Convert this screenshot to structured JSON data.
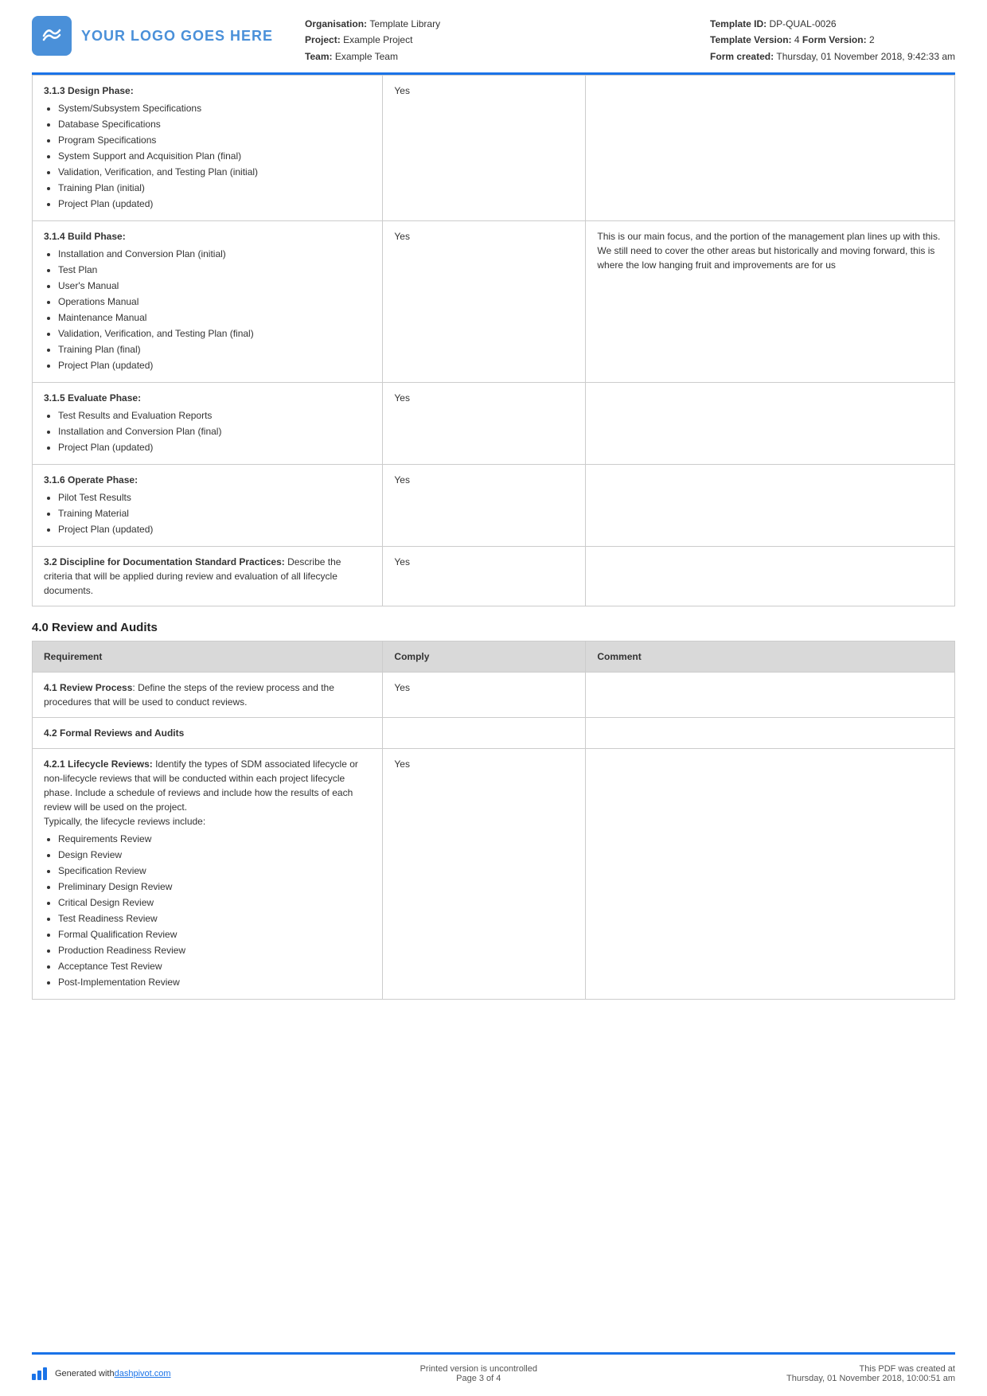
{
  "header": {
    "logo_text": "YOUR LOGO GOES HERE",
    "org_label": "Organisation:",
    "org_value": "Template Library",
    "project_label": "Project:",
    "project_value": "Example Project",
    "team_label": "Team:",
    "team_value": "Example Team",
    "template_id_label": "Template ID:",
    "template_id_value": "DP-QUAL-0026",
    "template_version_label": "Template Version:",
    "template_version_value": "4",
    "form_version_label": "Form Version:",
    "form_version_value": "2",
    "form_created_label": "Form created:",
    "form_created_value": "Thursday, 01 November 2018, 9:42:33 am"
  },
  "table1": {
    "rows": [
      {
        "id": "313",
        "requirement": "3.1.3 Design Phase:",
        "bullets": [
          "System/Subsystem Specifications",
          "Database Specifications",
          "Program Specifications",
          "System Support and Acquisition Plan (final)",
          "Validation, Verification, and Testing Plan (initial)",
          "Training Plan (initial)",
          "Project Plan (updated)"
        ],
        "comply": "Yes",
        "comment": ""
      },
      {
        "id": "314",
        "requirement": "3.1.4 Build Phase:",
        "bullets": [
          "Installation and Conversion Plan (initial)",
          "Test Plan",
          "User's Manual",
          "Operations Manual",
          "Maintenance Manual",
          "Validation, Verification, and Testing Plan (final)",
          "Training Plan (final)",
          "Project Plan (updated)"
        ],
        "comply": "Yes",
        "comment": "This is our main focus, and the portion of the management plan lines up with this. We still need to cover the other areas but historically and moving forward, this is where the low hanging fruit and improvements are for us"
      },
      {
        "id": "315",
        "requirement": "3.1.5 Evaluate Phase:",
        "bullets": [
          "Test Results and Evaluation Reports",
          "Installation and Conversion Plan (final)",
          "Project Plan (updated)"
        ],
        "comply": "Yes",
        "comment": ""
      },
      {
        "id": "316",
        "requirement": "3.1.6 Operate Phase:",
        "bullets": [
          "Pilot Test Results",
          "Training Material",
          "Project Plan (updated)"
        ],
        "comply": "Yes",
        "comment": ""
      },
      {
        "id": "32",
        "requirement_bold": "3.2 Discipline for Documentation Standard Practices:",
        "requirement_text": " Describe the criteria that will be applied during review and evaluation of all lifecycle documents.",
        "bullets": [],
        "comply": "Yes",
        "comment": ""
      }
    ]
  },
  "section2": {
    "heading": "4.0 Review and Audits"
  },
  "table2": {
    "header": {
      "col1": "Requirement",
      "col2": "Comply",
      "col3": "Comment"
    },
    "rows": [
      {
        "id": "41",
        "requirement_bold": "4.1 Review Process",
        "requirement_text": ": Define the steps of the review process and the procedures that will be used to conduct reviews.",
        "bullets": [],
        "comply": "Yes",
        "comment": ""
      },
      {
        "id": "42",
        "requirement_bold": "4.2 Formal Reviews and Audits",
        "requirement_text": "",
        "bullets": [],
        "comply": "",
        "comment": ""
      },
      {
        "id": "421",
        "requirement_bold": "4.2.1 Lifecycle Reviews:",
        "requirement_text": " Identify the types of SDM associated lifecycle or non-lifecycle reviews that will be conducted within each project lifecycle phase. Include a schedule of reviews and include how the results of each review will be used on the project.\nTypically, the lifecycle reviews include:",
        "bullets": [
          "Requirements Review",
          "Design Review",
          "Specification Review",
          "Preliminary Design Review",
          "Critical Design Review",
          "Test Readiness Review",
          "Formal Qualification Review",
          "Production Readiness Review",
          "Acceptance Test Review",
          "Post-Implementation Review"
        ],
        "comply": "Yes",
        "comment": ""
      }
    ]
  },
  "footer": {
    "generated_text": "Generated with ",
    "link_text": "dashpivot.com",
    "center_line1": "Printed version is uncontrolled",
    "center_line2": "Page 3 of 4",
    "right_line1": "This PDF was created at",
    "right_line2": "Thursday, 01 November 2018, 10:00:51 am"
  }
}
